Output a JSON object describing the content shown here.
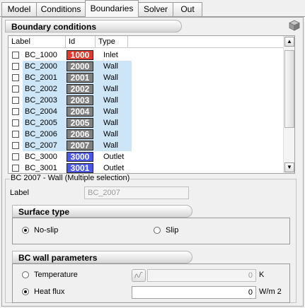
{
  "tabs": [
    {
      "label": "Model"
    },
    {
      "label": "Conditions"
    },
    {
      "label": "Boundaries"
    },
    {
      "label": "Solver"
    },
    {
      "label": "Out"
    }
  ],
  "active_tab": "Boundaries",
  "boundary_conditions": {
    "title": "Boundary conditions",
    "columns": [
      "Label",
      "Id",
      "Type"
    ],
    "rows": [
      {
        "label": "BC_1000",
        "id": "1000",
        "type": "Inlet",
        "id_color": "#e03a2e",
        "selected": false
      },
      {
        "label": "BC_2000",
        "id": "2000",
        "type": "Wall",
        "id_color": "#808080",
        "selected": true
      },
      {
        "label": "BC_2001",
        "id": "2001",
        "type": "Wall",
        "id_color": "#808080",
        "selected": true
      },
      {
        "label": "BC_2002",
        "id": "2002",
        "type": "Wall",
        "id_color": "#808080",
        "selected": true
      },
      {
        "label": "BC_2003",
        "id": "2003",
        "type": "Wall",
        "id_color": "#808080",
        "selected": true
      },
      {
        "label": "BC_2004",
        "id": "2004",
        "type": "Wall",
        "id_color": "#808080",
        "selected": true
      },
      {
        "label": "BC_2005",
        "id": "2005",
        "type": "Wall",
        "id_color": "#808080",
        "selected": true
      },
      {
        "label": "BC_2006",
        "id": "2006",
        "type": "Wall",
        "id_color": "#808080",
        "selected": true
      },
      {
        "label": "BC_2007",
        "id": "2007",
        "type": "Wall",
        "id_color": "#808080",
        "selected": true
      },
      {
        "label": "BC_3000",
        "id": "3000",
        "type": "Outlet",
        "id_color": "#4b57e6",
        "selected": false
      },
      {
        "label": "BC_3001",
        "id": "3001",
        "type": "Outlet",
        "id_color": "#4b57e6",
        "selected": false
      }
    ],
    "selection_color": "#cde6f7"
  },
  "details": {
    "group_title": "BC 2007 -  Wall  (Multiple selection)",
    "label_caption": "Label",
    "label_value": "BC_2007",
    "surface_type": {
      "title": "Surface type",
      "options": [
        "No-slip",
        "Slip"
      ],
      "selected": "No-slip"
    },
    "wall_params": {
      "title": "BC wall parameters",
      "temperature": {
        "label": "Temperature",
        "value": "0",
        "unit": "K",
        "selected": false
      },
      "heat_flux": {
        "label": "Heat flux",
        "value": "0",
        "unit": "W/m 2",
        "selected": true
      }
    }
  }
}
